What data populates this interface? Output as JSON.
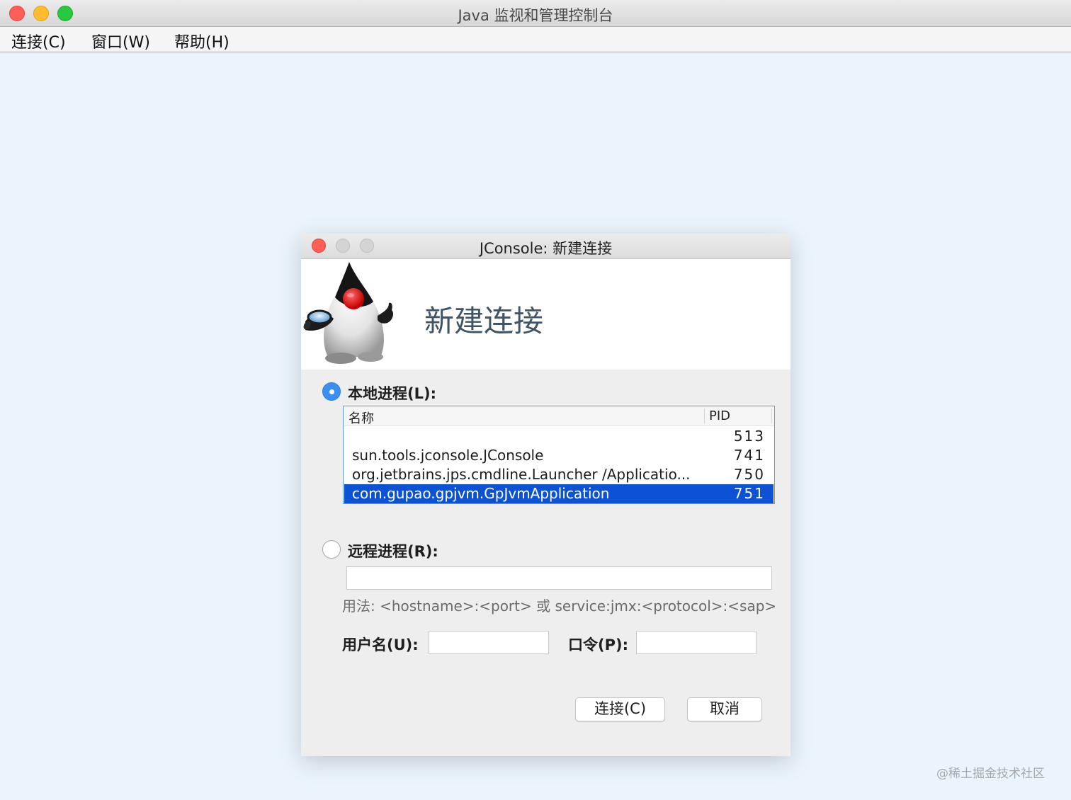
{
  "window": {
    "title": "Java 监视和管理控制台",
    "menu": [
      "连接(C)",
      "窗口(W)",
      "帮助(H)"
    ]
  },
  "dialog": {
    "title": "JConsole: 新建连接",
    "heading": "新建连接",
    "mascot_icon": "java-duke-mascot-icon",
    "local_process": {
      "label": "本地进程(L):",
      "selected": true,
      "columns": [
        "名称",
        "PID"
      ],
      "rows": [
        {
          "name": "",
          "pid": "513"
        },
        {
          "name": "sun.tools.jconsole.JConsole",
          "pid": "741"
        },
        {
          "name": "org.jetbrains.jps.cmdline.Launcher /Applicatio...",
          "pid": "750"
        },
        {
          "name": "com.gupao.gpjvm.GpJvmApplication",
          "pid": "751"
        }
      ],
      "selected_row": 3
    },
    "remote_process": {
      "label": "远程进程(R):",
      "selected": false,
      "value": "",
      "usage": "用法: <hostname>:<port> 或 service:jmx:<protocol>:<sap>"
    },
    "username_label": "用户名(U):",
    "username_value": "",
    "password_label": "口令(P):",
    "password_value": "",
    "connect_button": "连接(C)",
    "cancel_button": "取消"
  },
  "watermark": "@稀土掘金技术社区",
  "colors": {
    "desktop": "#ebf4fd",
    "selection": "#0c52d2",
    "radio_accent": "#3b8ff0",
    "heading": "#3f5567"
  }
}
